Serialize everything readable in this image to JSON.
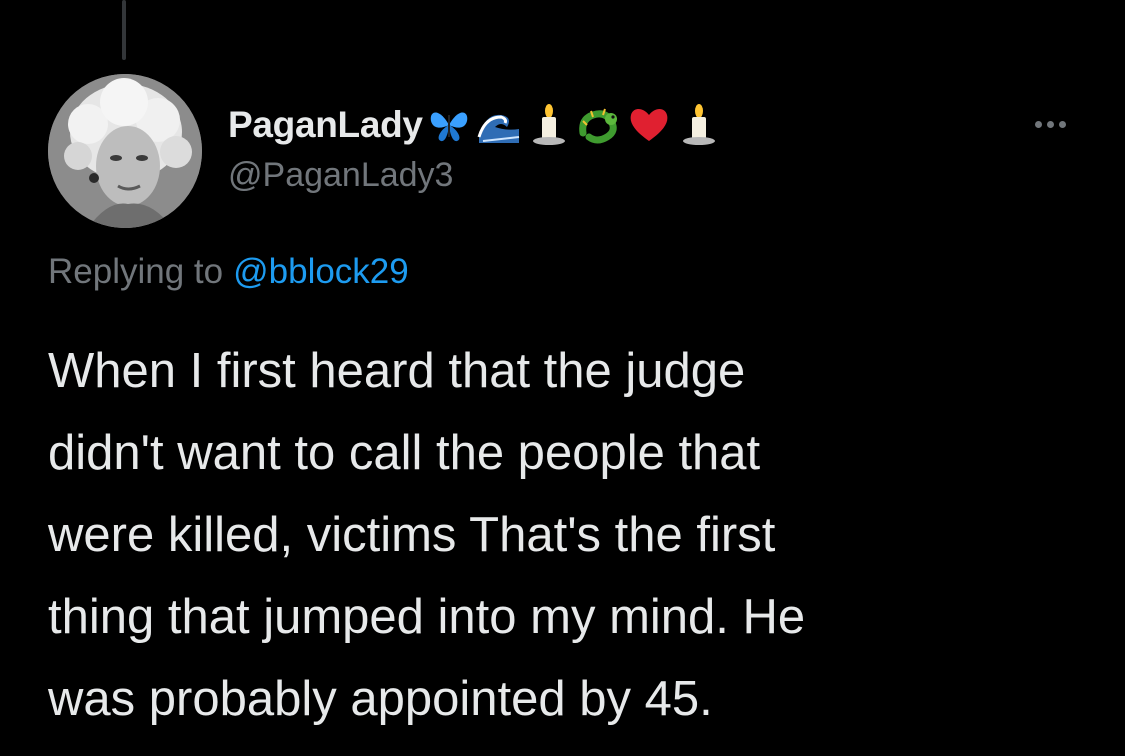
{
  "tweet": {
    "author": {
      "display_name": "PaganLady",
      "handle": "@PaganLady3",
      "name_emojis": [
        "butterfly-emoji",
        "wave-emoji",
        "candle-emoji",
        "dragon-emoji",
        "red-heart-emoji",
        "candle-emoji"
      ]
    },
    "replying_to_label": "Replying to",
    "replying_to_handle": "@bblock29",
    "text": "When I first heard that the judge\ndidn't want to call the people that\nwere killed, victims That's the first\nthing that jumped into my mind. He\nwas probably appointed by 45."
  },
  "colors": {
    "background": "#000000",
    "primary_text": "#e7e9ea",
    "secondary_text": "#71767b",
    "link": "#1d9bf0"
  },
  "icons": {
    "more": "more-horizontal-icon"
  }
}
